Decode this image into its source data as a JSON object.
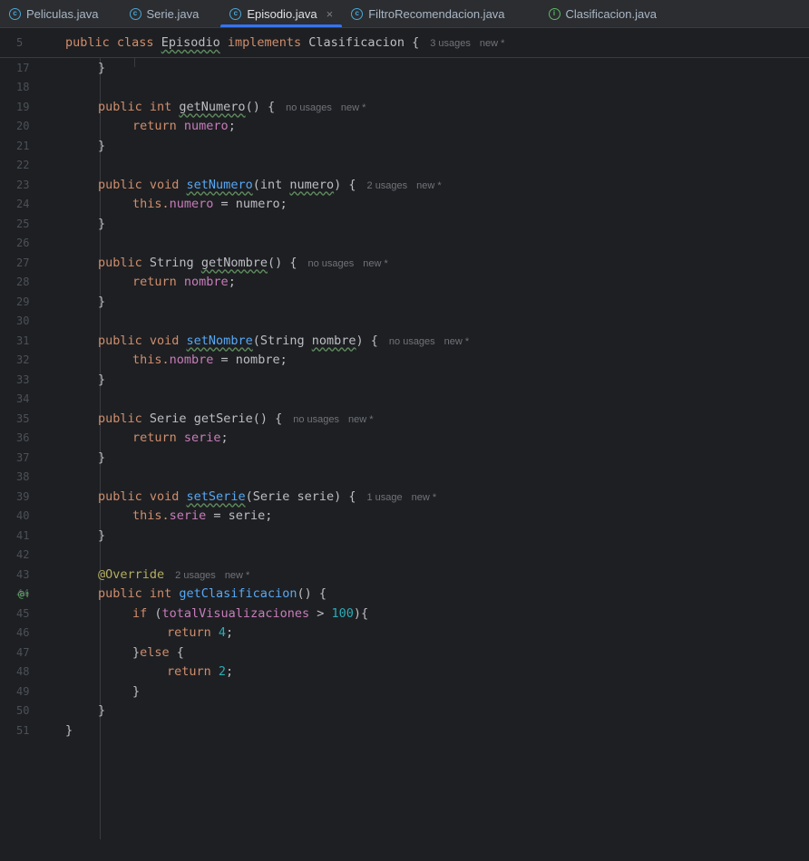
{
  "tabs": [
    {
      "label": "Peliculas.java",
      "icon": "class-icon",
      "active": false
    },
    {
      "label": "Serie.java",
      "icon": "class-icon",
      "active": false
    },
    {
      "label": "Episodio.java",
      "icon": "class-icon",
      "active": true,
      "close": "×"
    },
    {
      "label": "FiltroRecomendacion.java",
      "icon": "class-icon",
      "active": false
    },
    {
      "label": "Clasificacion.java",
      "icon": "interface-icon",
      "active": false
    }
  ],
  "sticky": {
    "line_number": "5",
    "kw1": "public",
    "kw2": "class",
    "name": "Episodio",
    "kw3": "implements",
    "iface": "Clasificacion",
    "brace": "{",
    "hint_usages": "3 usages",
    "hint_new": "new *"
  },
  "lines": {
    "l17": {
      "n": "17",
      "code": "}"
    },
    "l18": {
      "n": "18"
    },
    "l19": {
      "n": "19",
      "kw": "public int ",
      "name": "getNumero",
      "rest": "() {",
      "u": "no usages",
      "nw": "new *"
    },
    "l20": {
      "n": "20",
      "kw": "return ",
      "val": "numero",
      "end": ";"
    },
    "l21": {
      "n": "21",
      "code": "}"
    },
    "l22": {
      "n": "22"
    },
    "l23": {
      "n": "23",
      "kw": "public void ",
      "name": "setNumero",
      "p1": "(int ",
      "param": "numero",
      "p2": ") {",
      "u": "2 usages",
      "nw": "new *"
    },
    "l24": {
      "n": "24",
      "kw": "this.",
      "field": "numero",
      "rest": " = numero;"
    },
    "l25": {
      "n": "25",
      "code": "}"
    },
    "l26": {
      "n": "26"
    },
    "l27": {
      "n": "27",
      "kw": "public ",
      "type": "String ",
      "name": "getNombre",
      "rest": "() {",
      "u": "no usages",
      "nw": "new *"
    },
    "l28": {
      "n": "28",
      "kw": "return ",
      "val": "nombre",
      "end": ";"
    },
    "l29": {
      "n": "29",
      "code": "}"
    },
    "l30": {
      "n": "30"
    },
    "l31": {
      "n": "31",
      "kw": "public void ",
      "name": "setNombre",
      "p1": "(String ",
      "param": "nombre",
      "p2": ") {",
      "u": "no usages",
      "nw": "new *"
    },
    "l32": {
      "n": "32",
      "kw": "this.",
      "field": "nombre",
      "rest": " = nombre;"
    },
    "l33": {
      "n": "33",
      "code": "}"
    },
    "l34": {
      "n": "34"
    },
    "l35": {
      "n": "35",
      "kw": "public ",
      "type": "Serie ",
      "name": "getSerie",
      "rest": "() {",
      "u": "no usages",
      "nw": "new *"
    },
    "l36": {
      "n": "36",
      "kw": "return ",
      "val": "serie",
      "end": ";"
    },
    "l37": {
      "n": "37",
      "code": "}"
    },
    "l38": {
      "n": "38"
    },
    "l39": {
      "n": "39",
      "kw": "public void ",
      "name": "setSerie",
      "p1": "(Serie serie) {",
      "u": "1 usage",
      "nw": "new *"
    },
    "l40": {
      "n": "40",
      "kw": "this.",
      "field": "serie",
      "rest": " = serie;"
    },
    "l41": {
      "n": "41",
      "code": "}"
    },
    "l42": {
      "n": "42"
    },
    "l43": {
      "n": "43",
      "ann": "@Override",
      "u": "2 usages",
      "nw": "new *"
    },
    "l44": {
      "n": "44",
      "gutter": "@↑",
      "kw": "public int ",
      "name": "getClasificacion",
      "rest": "() {"
    },
    "l45": {
      "n": "45",
      "kw": "if ",
      "p1": "(",
      "field": "totalVisualizaciones",
      "op": " > ",
      "num": "100",
      "p2": "){"
    },
    "l46": {
      "n": "46",
      "kw": "return ",
      "num": "4",
      "end": ";"
    },
    "l47": {
      "n": "47",
      "b": "}",
      "kw": "else ",
      "rest": "{"
    },
    "l48": {
      "n": "48",
      "kw": "return ",
      "num": "2",
      "end": ";"
    },
    "l49": {
      "n": "49",
      "code": "}"
    },
    "l50": {
      "n": "50",
      "code": "}"
    },
    "l51": {
      "n": "51",
      "code": "}"
    }
  }
}
